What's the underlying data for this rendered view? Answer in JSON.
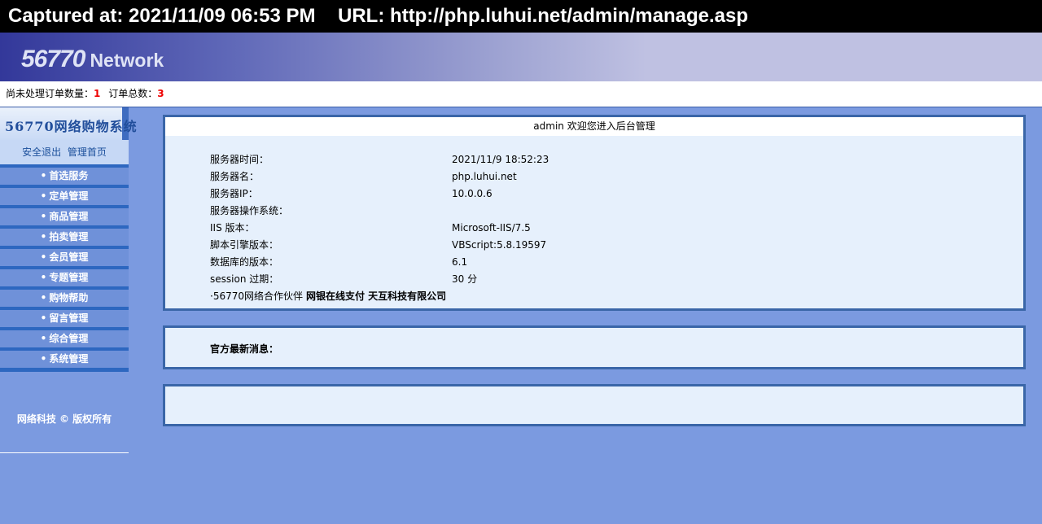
{
  "capture": {
    "time_label": "Captured at: 2021/11/09 06:53 PM",
    "url_label": "URL: http://php.luhui.net/admin/manage.asp"
  },
  "banner": {
    "logo_num": "56770",
    "logo_text": "Network"
  },
  "orders": {
    "pending_label": "尚未处理订单数量：",
    "pending_count": "1",
    "total_label": "订单总数：",
    "total_count": "3"
  },
  "sidebar": {
    "title": "56770网络购物系统",
    "logout": "安全退出",
    "home": "管理首页",
    "items": [
      "首选服务",
      "定单管理",
      "商品管理",
      "拍卖管理",
      "会员管理",
      "专题管理",
      "购物帮助",
      "留言管理",
      "综合管理",
      "系统管理"
    ],
    "copyright": "网络科技 © 版权所有"
  },
  "welcome": {
    "title": "admin 欢迎您进入后台管理"
  },
  "server_info": [
    {
      "key": "服务器时间：",
      "value": "2021/11/9 18:52:23"
    },
    {
      "key": "服务器名：",
      "value": "php.luhui.net"
    },
    {
      "key": "服务器IP：",
      "value": "10.0.0.6"
    },
    {
      "key": "服务器操作系统：",
      "value": ""
    },
    {
      "key": "IIS 版本：",
      "value": "Microsoft-IIS/7.5"
    },
    {
      "key": "脚本引擎版本：",
      "value": "VBScript:5.8.19597"
    },
    {
      "key": "数据库的版本：",
      "value": "6.1"
    },
    {
      "key": "session 过期：",
      "value": "30 分"
    }
  ],
  "partner": {
    "label": "·56770网络合作伙伴",
    "links": "网银在线支付 天互科技有限公司"
  },
  "news": {
    "label": "官方最新消息："
  }
}
